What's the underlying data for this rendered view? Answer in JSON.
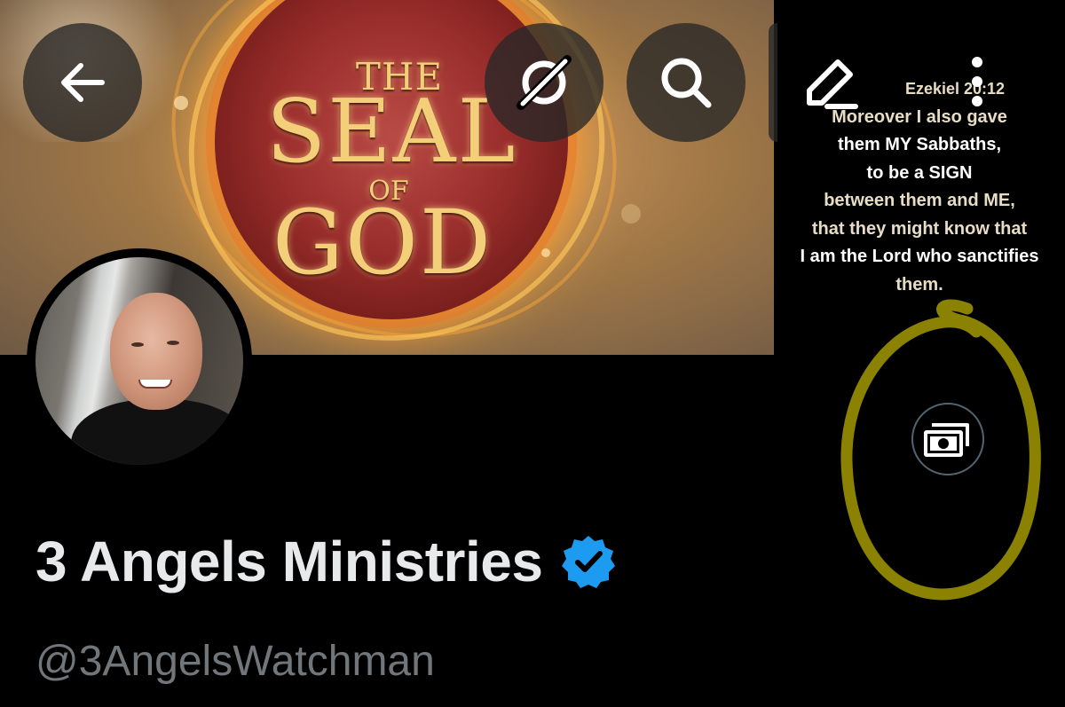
{
  "banner": {
    "title_line1": "THE",
    "title_line2": "SEAL",
    "title_line3": "OF",
    "title_line4": "GOD"
  },
  "toolbar": {
    "back_icon": "arrow-left-icon",
    "grok_icon": "grok-icon",
    "search_icon": "search-icon",
    "edit_icon": "pencil-icon",
    "more_icon": "more-vertical-icon"
  },
  "verse": {
    "lines": [
      "Ezekiel 20:12",
      "Moreover I also gave",
      "them MY Sabbaths,",
      "to be a SIGN",
      "between them and ME,",
      "that they might know that",
      "I am the Lord who sanctifies",
      "them."
    ]
  },
  "profile": {
    "name": "3 Angels Ministries",
    "handle": "@3AngelsWatchman",
    "verified": true,
    "verified_color": "#1d9bf0"
  },
  "tip": {
    "icon": "money-icon"
  },
  "annotation": {
    "color": "#8a8200"
  }
}
